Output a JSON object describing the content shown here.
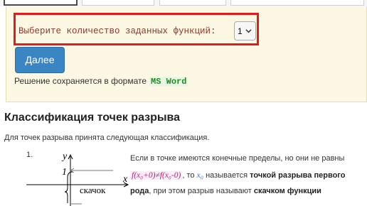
{
  "calculator": {
    "function_count_label": "Выберите количество заданных функций:",
    "function_count_value": "1",
    "next_button": "Далее",
    "format_text": "Решение сохраняется в формате",
    "format_name": "MS Word"
  },
  "article": {
    "heading": "Классификация точек разрыва",
    "intro": "Для точек разрыва принята следующая классификация.",
    "item1": {
      "number": "1.",
      "text_1": "Если в точке имеются конечные пределы, но они не равны",
      "formula": "f(x₀+0)≠f(x₀-0)",
      "text_2": ", то",
      "x0": "x₀",
      "text_3": "называется",
      "bold_1": "точкой разрыва первого рода",
      "text_4": ", при этом разрыв называют",
      "bold_2": "скачком функции",
      "graph": {
        "y_axis": "y",
        "x_axis": "x",
        "tick_label": "1",
        "jump_label": "скачок"
      }
    }
  },
  "icons": {
    "select_chevron": "chevron-down-icon"
  }
}
